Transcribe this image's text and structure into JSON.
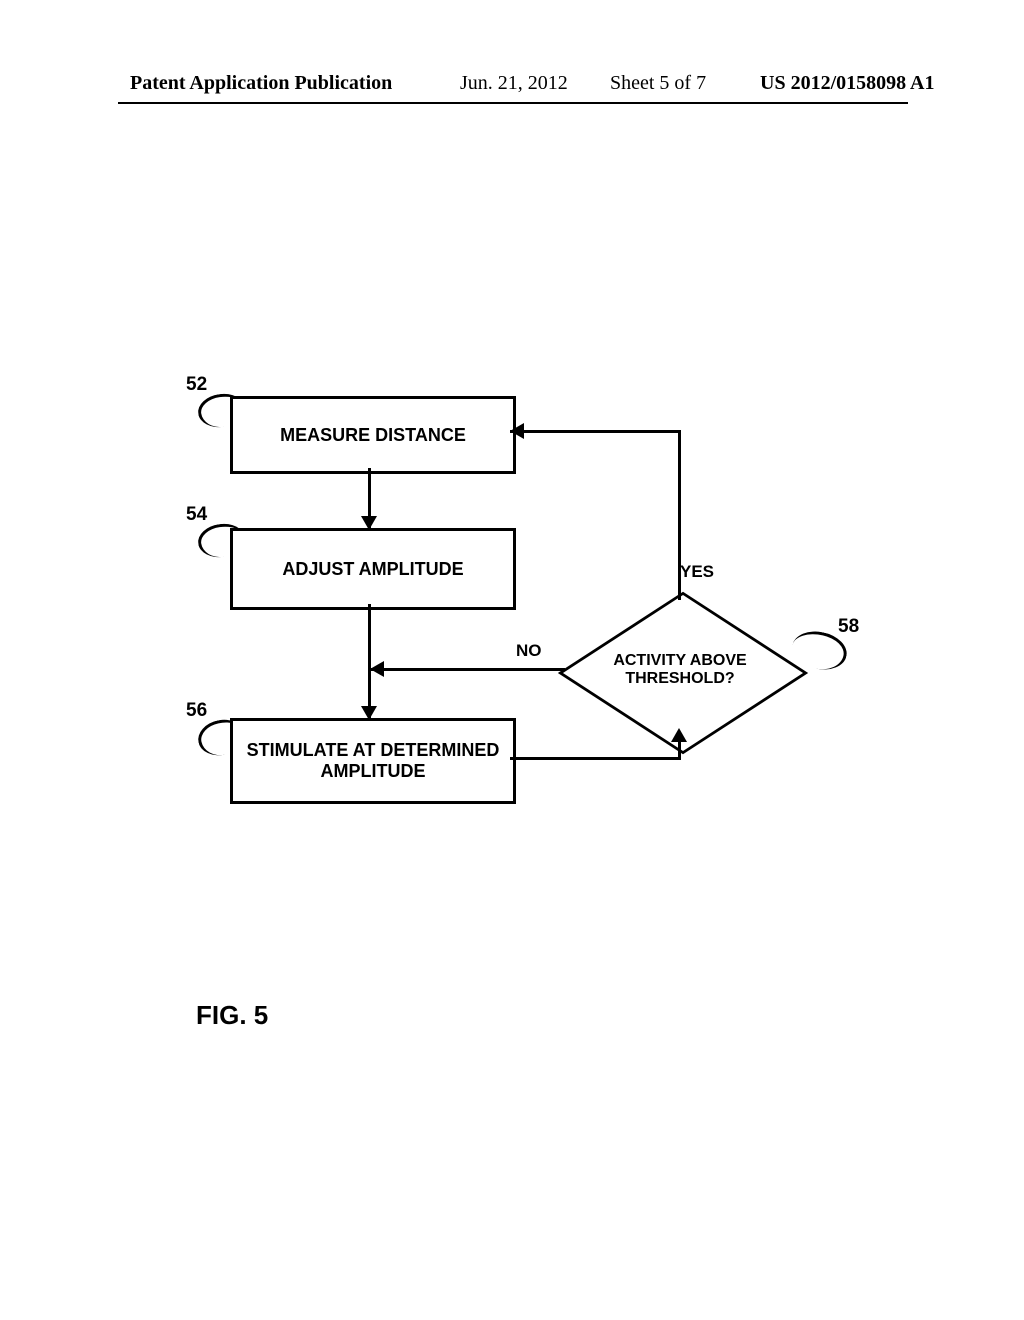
{
  "header": {
    "publication": "Patent Application Publication",
    "date": "Jun. 21, 2012",
    "sheet": "Sheet 5 of 7",
    "appno": "US 2012/0158098 A1"
  },
  "refs": {
    "r52": "52",
    "r54": "54",
    "r56": "56",
    "r58": "58"
  },
  "boxes": {
    "b1": "MEASURE DISTANCE",
    "b2": "ADJUST AMPLITUDE",
    "b3": "STIMULATE AT DETERMINED AMPLITUDE"
  },
  "decision": {
    "text": "ACTIVITY ABOVE THRESHOLD?",
    "yes": "YES",
    "no": "NO"
  },
  "figure_caption": "FIG. 5",
  "chart_data": {
    "type": "diagram",
    "kind": "flowchart",
    "nodes": [
      {
        "id": "52",
        "type": "process",
        "label": "MEASURE DISTANCE"
      },
      {
        "id": "54",
        "type": "process",
        "label": "ADJUST AMPLITUDE"
      },
      {
        "id": "56",
        "type": "process",
        "label": "STIMULATE AT DETERMINED AMPLITUDE"
      },
      {
        "id": "58",
        "type": "decision",
        "label": "ACTIVITY ABOVE THRESHOLD?"
      }
    ],
    "edges": [
      {
        "from": "52",
        "to": "54",
        "label": ""
      },
      {
        "from": "54",
        "to": "56",
        "label": ""
      },
      {
        "from": "56",
        "to": "58",
        "label": ""
      },
      {
        "from": "58",
        "to": "52",
        "label": "YES"
      },
      {
        "from": "58",
        "to": "56",
        "label": "NO"
      }
    ],
    "title": "FIG. 5"
  }
}
